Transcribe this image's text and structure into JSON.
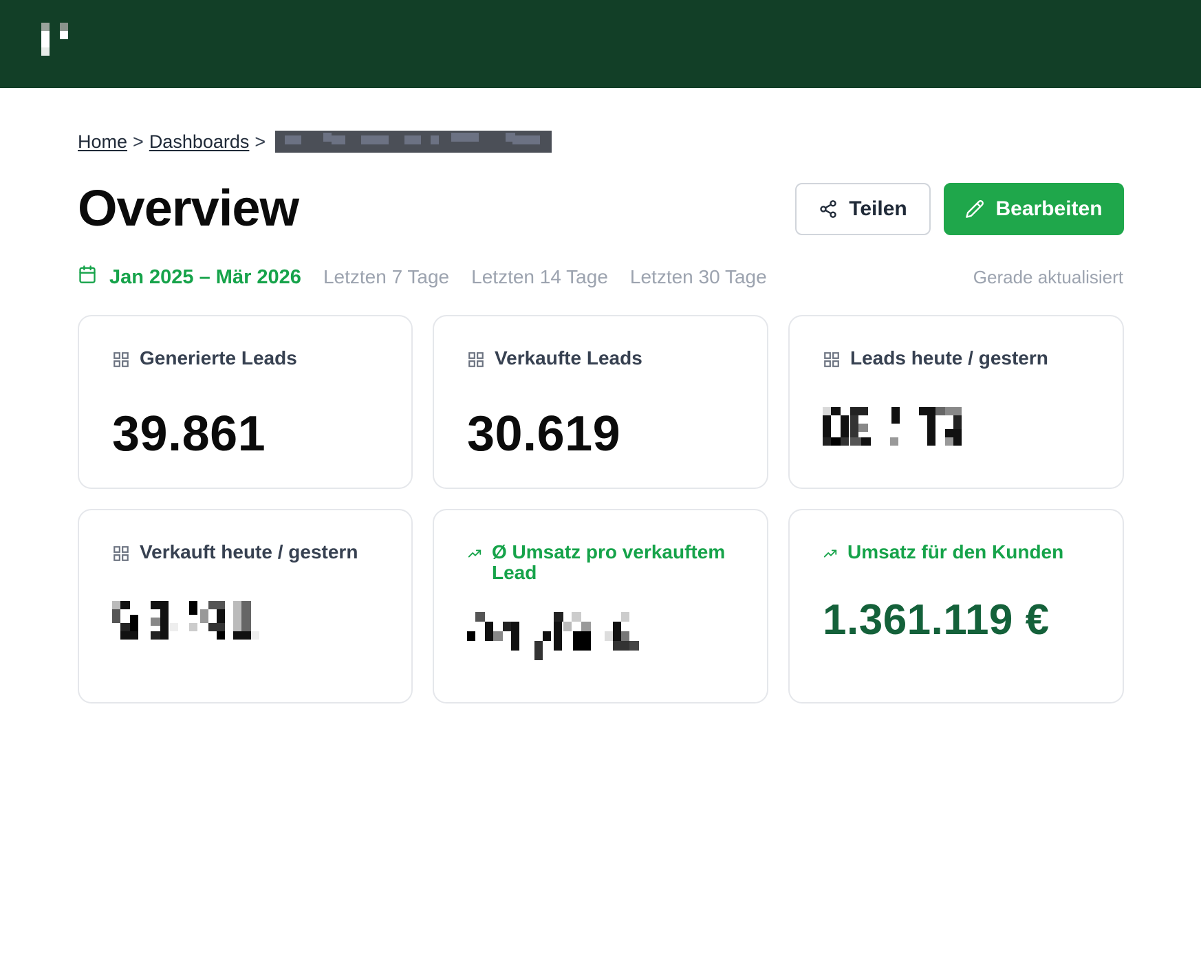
{
  "topbar": {
    "logo": "logo-mark"
  },
  "breadcrumb": {
    "home": "Home",
    "dashboards": "Dashboards",
    "separator": ">"
  },
  "page": {
    "title": "Overview"
  },
  "actions": {
    "share_label": "Teilen",
    "edit_label": "Bearbeiten"
  },
  "filters": {
    "date_range": "Jan 2025 – Mär 2026",
    "quick": [
      "Letzten 7 Tage",
      "Letzten 14 Tage",
      "Letzten 30 Tage"
    ],
    "status": "Gerade aktualisiert"
  },
  "cards": [
    {
      "label": "Generierte Leads",
      "value": "39.861",
      "icon": "grid-icon"
    },
    {
      "label": "Verkaufte Leads",
      "value": "30.619",
      "icon": "grid-icon"
    },
    {
      "label": "Leads heute / gestern",
      "icon": "grid-icon"
    },
    {
      "label": "Verkauft heute / gestern",
      "icon": "grid-icon"
    },
    {
      "label": "Ø Umsatz pro verkauftem Lead",
      "icon": "trend-icon"
    },
    {
      "label": "Umsatz für den Kunden",
      "value": "1.361.119 €",
      "icon": "trend-icon"
    }
  ],
  "colors": {
    "topbar": "#123f27",
    "accent": "#1fa74b",
    "accent_text": "#16a34a",
    "money": "#14613a"
  }
}
